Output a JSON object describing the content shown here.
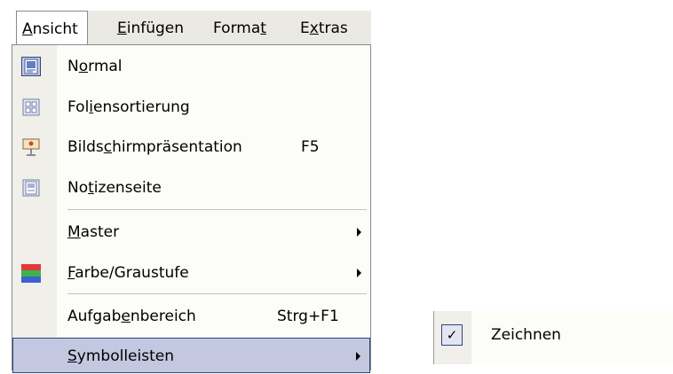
{
  "menubar": {
    "items": [
      {
        "pre": "",
        "key": "A",
        "post": "nsicht"
      },
      {
        "pre": "",
        "key": "E",
        "post": "infügen"
      },
      {
        "pre": "Forma",
        "key": "t",
        "post": ""
      },
      {
        "pre": "E",
        "key": "x",
        "post": "tras"
      }
    ]
  },
  "menu": {
    "normal": {
      "pre": "N",
      "key": "o",
      "post": "rmal"
    },
    "sorter": {
      "pre": "Fol",
      "key": "i",
      "post": "ensortierung"
    },
    "slideshow": {
      "pre": "Bilds",
      "key": "c",
      "post": "hirmpräsentation",
      "shortcut": "F5"
    },
    "notes": {
      "pre": "No",
      "key": "t",
      "post": "izenseite"
    },
    "master": {
      "pre": "",
      "key": "M",
      "post": "aster"
    },
    "color": {
      "pre": "",
      "key": "F",
      "post": "arbe/Graustufe"
    },
    "taskpane": {
      "pre": "Aufgab",
      "key": "e",
      "post": "nbereich",
      "shortcut": "Strg+F1"
    },
    "toolbars": {
      "pre": "",
      "key": "S",
      "post": "ymbolleisten"
    }
  },
  "submenu": {
    "drawing_label": "Zeichnen",
    "check_glyph": "✓"
  },
  "colors": {
    "highlight_fill": "#c3c8e0",
    "highlight_border": "#31437a",
    "menubar_bg": "#ebe9e3",
    "gutter_bg": "#f0efe9"
  }
}
